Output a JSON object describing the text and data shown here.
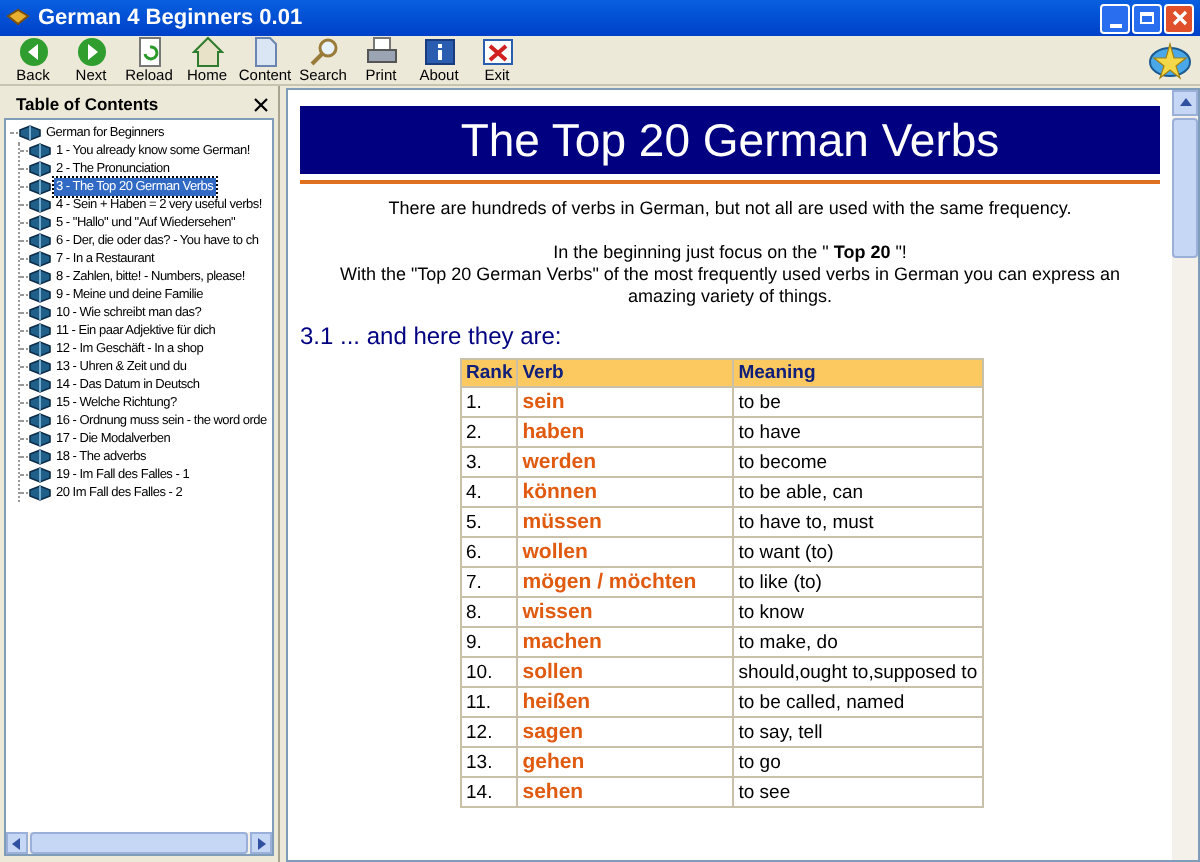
{
  "window": {
    "title": "German 4 Beginners 0.01"
  },
  "toolbar": [
    {
      "label": "Back",
      "kind": "back"
    },
    {
      "label": "Next",
      "kind": "next"
    },
    {
      "label": "Reload",
      "kind": "reload"
    },
    {
      "label": "Home",
      "kind": "home"
    },
    {
      "label": "Content",
      "kind": "content"
    },
    {
      "label": "Search",
      "kind": "search"
    },
    {
      "label": "Print",
      "kind": "print"
    },
    {
      "label": "About",
      "kind": "about"
    },
    {
      "label": "Exit",
      "kind": "exit"
    }
  ],
  "sidebar": {
    "title": "Table of Contents",
    "tree": [
      {
        "label": "German for Beginners",
        "selected": false,
        "children": [
          {
            "label": "1 - You already know some German!",
            "selected": false
          },
          {
            "label": "2 - The Pronunciation",
            "selected": false
          },
          {
            "label": "3 - The Top 20 German Verbs",
            "selected": true
          },
          {
            "label": "4 - Sein + Haben = 2 very useful verbs!",
            "selected": false
          },
          {
            "label": "5 - \"Hallo\" und \"Auf Wiedersehen\"",
            "selected": false
          },
          {
            "label": "6 - Der, die oder das? - You have to ch",
            "selected": false
          },
          {
            "label": "7 - In a Restaurant",
            "selected": false
          },
          {
            "label": "8 - Zahlen, bitte! - Numbers, please!",
            "selected": false
          },
          {
            "label": "9 - Meine und deine Familie",
            "selected": false
          },
          {
            "label": "10 - Wie schreibt man das?",
            "selected": false
          },
          {
            "label": "11 - Ein paar Adjektive für dich",
            "selected": false
          },
          {
            "label": "12 - Im Geschäft - In a shop",
            "selected": false
          },
          {
            "label": "13 - Uhren & Zeit und du",
            "selected": false
          },
          {
            "label": "14 - Das Datum in Deutsch",
            "selected": false
          },
          {
            "label": "15 - Welche Richtung?",
            "selected": false
          },
          {
            "label": "16 - Ordnung muss sein - the word orde",
            "selected": false
          },
          {
            "label": "17 - Die Modalverben",
            "selected": false
          },
          {
            "label": "18 - The adverbs",
            "selected": false
          },
          {
            "label": "19 - Im Fall des Falles - 1",
            "selected": false
          },
          {
            "label": "20 Im Fall des Falles - 2",
            "selected": false
          }
        ]
      }
    ]
  },
  "content": {
    "heading": "The Top 20 German Verbs",
    "paragraphs": [
      "There are hundreds of verbs in German, but not all are used with the same frequency.",
      "In the beginning just focus on the \" **Top 20** \"!",
      "With the \"Top 20 German Verbs\" of the most frequently used verbs in German you can express an amazing variety of things."
    ],
    "section_heading": "3.1 ... and here they are:",
    "table": {
      "columns": [
        "Rank",
        "Verb",
        "Meaning"
      ],
      "rows": [
        [
          "1.",
          "sein",
          "to be"
        ],
        [
          "2.",
          "haben",
          "to have"
        ],
        [
          "3.",
          "werden",
          "to become"
        ],
        [
          "4.",
          "können",
          "to be able, can"
        ],
        [
          "5.",
          "müssen",
          "to have to, must"
        ],
        [
          "6.",
          "wollen",
          "to want (to)"
        ],
        [
          "7.",
          "mögen / möchten",
          "to like (to)"
        ],
        [
          "8.",
          "wissen",
          "to know"
        ],
        [
          "9.",
          "machen",
          "to make, do"
        ],
        [
          "10.",
          "sollen",
          "should,ought to,supposed to"
        ],
        [
          "11.",
          "heißen",
          "to be called, named"
        ],
        [
          "12.",
          "sagen",
          "to say, tell"
        ],
        [
          "13.",
          "gehen",
          "to go"
        ],
        [
          "14.",
          "sehen",
          "to see"
        ]
      ]
    }
  }
}
